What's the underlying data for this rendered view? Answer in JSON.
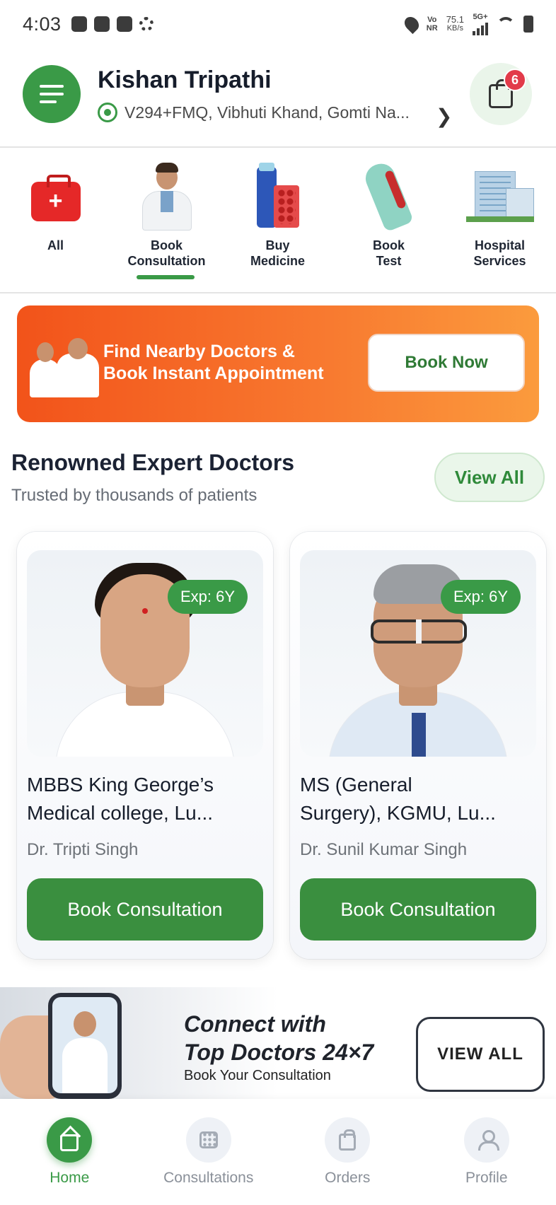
{
  "status_bar": {
    "time": "4:03",
    "net_1": "Vo",
    "net_2": "NR",
    "speed_value": "75.1",
    "speed_unit": "KB/s",
    "signal": "5G+"
  },
  "header": {
    "user_name": "Kishan Tripathi",
    "location": "V294+FMQ, Vibhuti Khand, Gomti Na...",
    "cart_count": "6"
  },
  "categories": [
    {
      "label": "All",
      "icon": "first-aid-kit-icon",
      "selected": false
    },
    {
      "label": "Book\nConsultation",
      "icon": "doctor-icon",
      "selected": true
    },
    {
      "label": "Buy\nMedicine",
      "icon": "medicine-icon",
      "selected": false
    },
    {
      "label": "Book\nTest",
      "icon": "blood-test-icon",
      "selected": false
    },
    {
      "label": "Hospital\nServices",
      "icon": "hospital-icon",
      "selected": false
    }
  ],
  "banner": {
    "line1": "Find Nearby Doctors &",
    "line2": "Book Instant Appointment",
    "button": "Book Now"
  },
  "doctors_section": {
    "title": "Renowned Expert Doctors",
    "subtitle": "Trusted by thousands of patients",
    "view_all": "View All"
  },
  "doctors": [
    {
      "experience": "Exp: 6Y",
      "qualifications": "MBBS  King George’s\nMedical college, Lu...",
      "name": "Dr. Tripti Singh",
      "button": "Book Consultation"
    },
    {
      "experience": "Exp: 6Y",
      "qualifications": "MS (General\nSurgery), KGMU, Lu...",
      "name": "Dr. Sunil Kumar Singh",
      "button": "Book Consultation"
    }
  ],
  "promo": {
    "title": "Connect with\nTop Doctors 24×7",
    "subtitle": "Book Your Consultation",
    "button": "VIEW ALL"
  },
  "bottom_nav": [
    {
      "label": "Home",
      "icon": "home-icon",
      "active": true
    },
    {
      "label": "Consultations",
      "icon": "calendar-icon",
      "active": false
    },
    {
      "label": "Orders",
      "icon": "shopping-bag-icon",
      "active": false
    },
    {
      "label": "Profile",
      "icon": "user-icon",
      "active": false
    }
  ],
  "colors": {
    "primary_green": "#3a9a47",
    "banner_orange": "#f2531a",
    "badge_red": "#e23b4a"
  }
}
